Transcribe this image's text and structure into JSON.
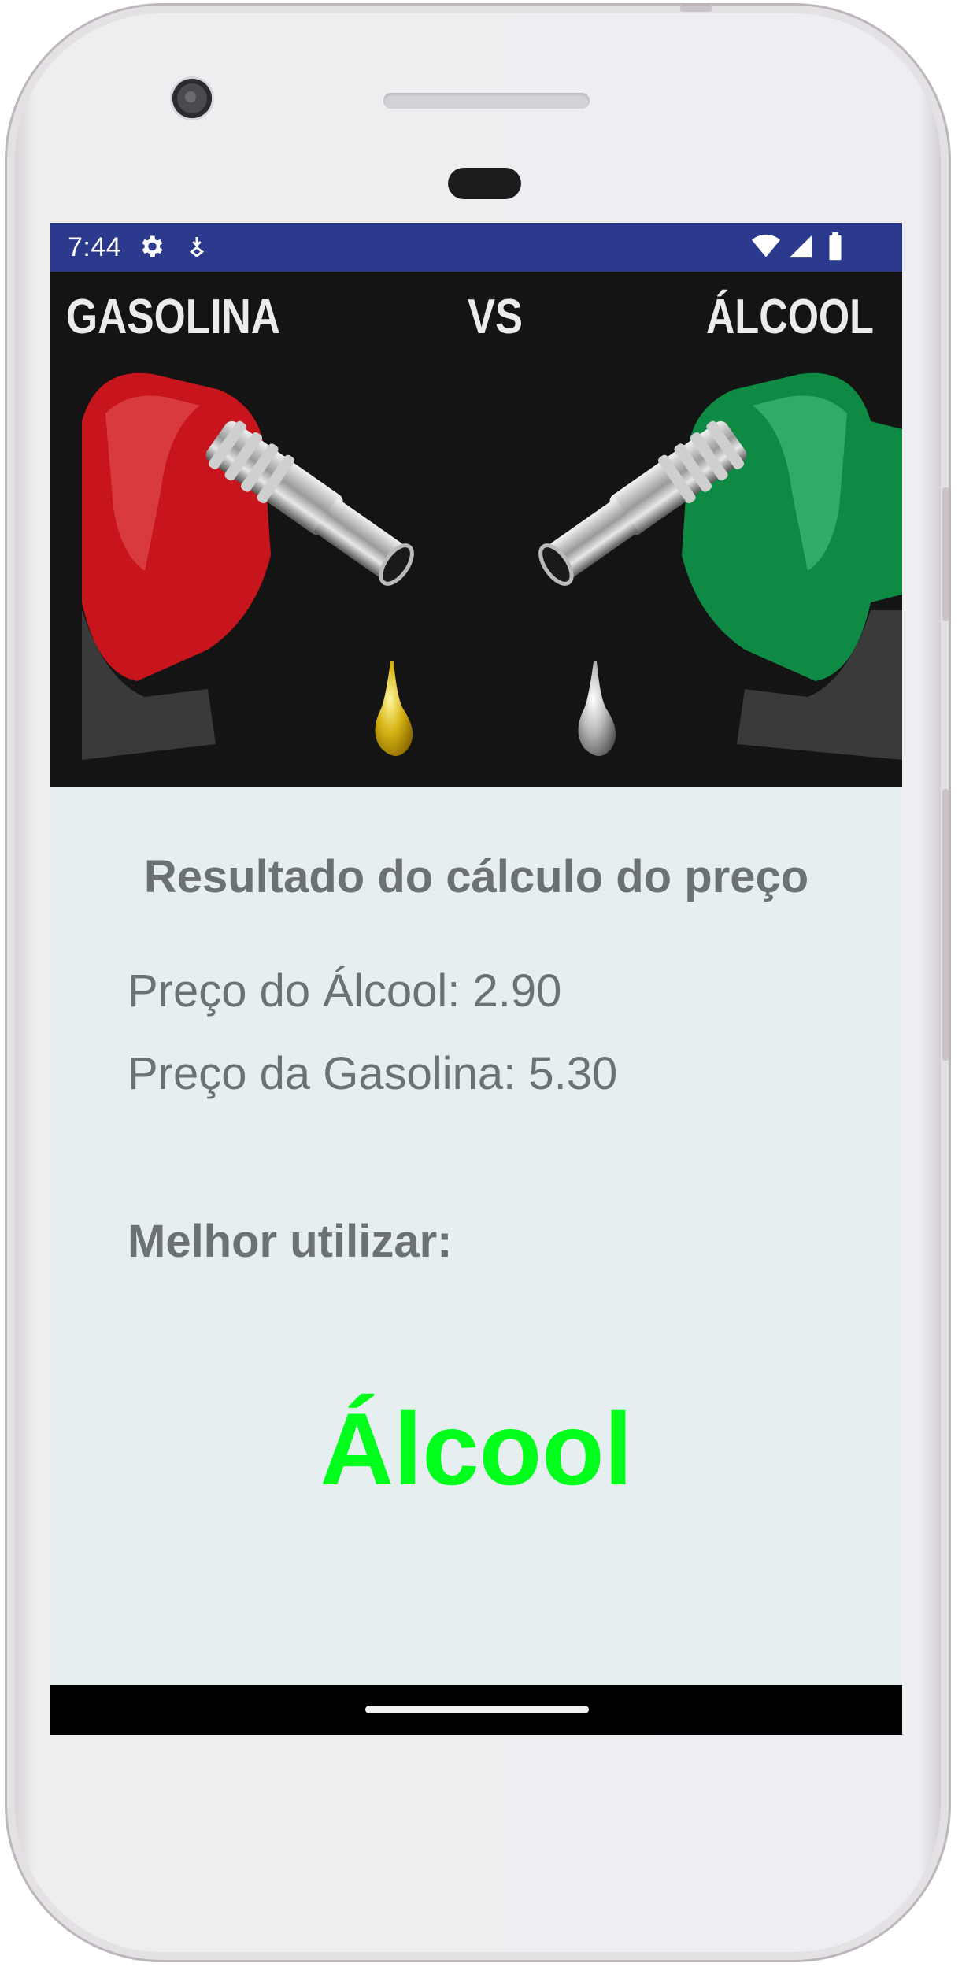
{
  "status_bar": {
    "time": "7:44",
    "icons": [
      "gear-icon",
      "download-icon",
      "wifi-icon",
      "signal-icon",
      "battery-icon"
    ],
    "background": "#2c3a8e"
  },
  "hero": {
    "left_label": "GASOLINA",
    "center_label": "VS",
    "right_label": "ÁLCOOL",
    "left_nozzle_color": "#c8141c",
    "right_nozzle_color": "#0f8a44"
  },
  "result_screen": {
    "title": "Resultado do cálculo do preço",
    "alcohol_price": "Preço do Álcool: 2.90",
    "gasoline_price": "Preço da Gasolina: 5.30",
    "best_label": "Melhor utilizar:",
    "best_choice": "Álcool",
    "best_choice_color": "#00ff1a",
    "background": "#e6eef0"
  }
}
